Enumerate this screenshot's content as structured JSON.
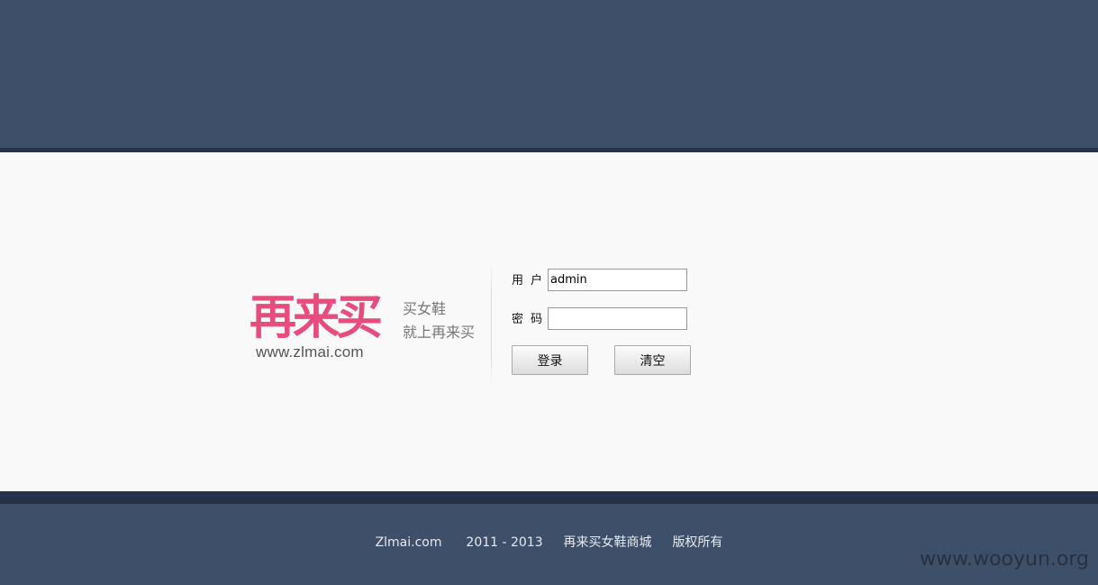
{
  "brand": {
    "logo_text": "再来买",
    "url": "www.zlmai.com",
    "slogan_line1": "买女鞋",
    "slogan_line2": "就上再来买",
    "color": "#e64c7c"
  },
  "login": {
    "username_label": "用 户",
    "username_value": "admin",
    "password_label": "密 码",
    "password_value": "",
    "login_button": "登录",
    "clear_button": "清空"
  },
  "footer": {
    "site": "Zlmai.com",
    "years": "2011 - 2013",
    "company": "再来买女鞋商城",
    "rights": "版权所有"
  },
  "watermark": "www.wooyun.org",
  "colors": {
    "header_bg": "#3e4f6a",
    "strip": "#25324a",
    "footer_bg": "#3e5069"
  }
}
